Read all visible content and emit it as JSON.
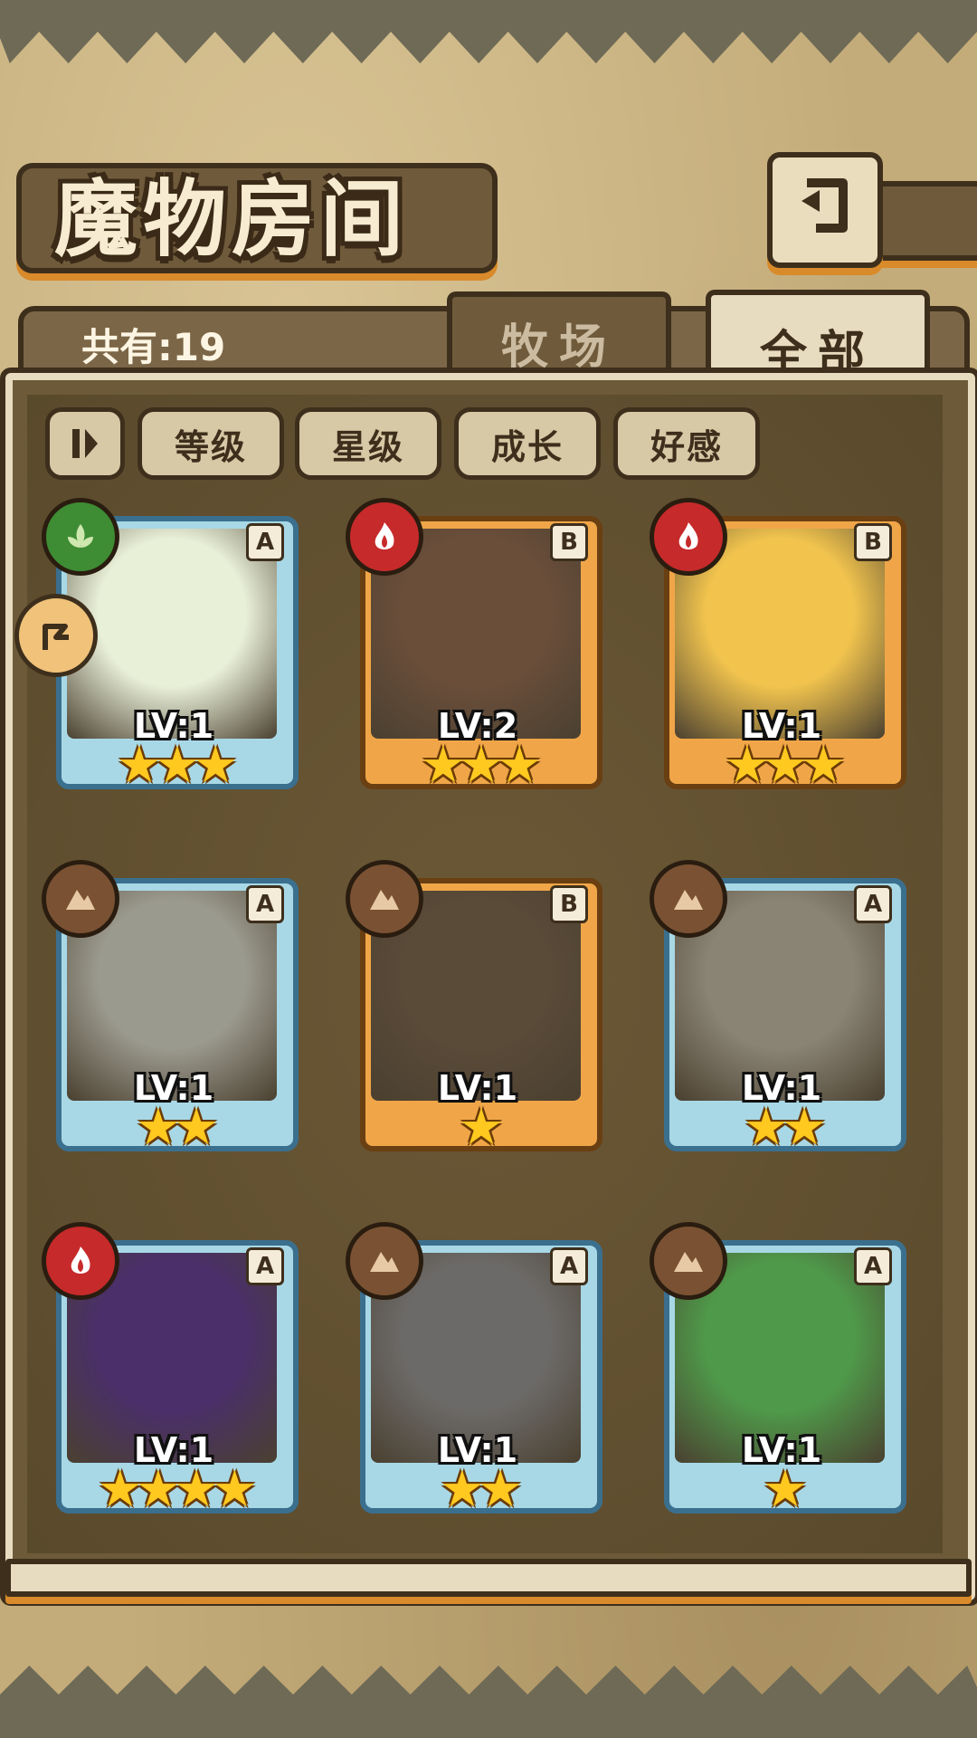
{
  "header": {
    "title": "魔物房间",
    "back_icon": "back-arrow-icon"
  },
  "tabs": {
    "count_label": "共有:19",
    "pasture": "牧场",
    "all": "全部"
  },
  "filters": {
    "toggle_icon": "pause-sort-icon",
    "buttons": [
      "等级",
      "星级",
      "成长",
      "好感"
    ]
  },
  "cards": [
    {
      "rank": "A",
      "element": "wood",
      "level": "LV:1",
      "stars": "★★★",
      "frame": "blue",
      "portrait_color": "#e9f0d8"
    },
    {
      "rank": "B",
      "element": "fire",
      "level": "LV:2",
      "stars": "★★★",
      "frame": "orange",
      "portrait_color": "#6a4e3a"
    },
    {
      "rank": "B",
      "element": "fire",
      "level": "LV:1",
      "stars": "★★★",
      "frame": "orange",
      "portrait_color": "#f2c44e"
    },
    {
      "rank": "A",
      "element": "earth",
      "level": "LV:1",
      "stars": "★★",
      "frame": "blue",
      "portrait_color": "#9b9a8e"
    },
    {
      "rank": "B",
      "element": "earth",
      "level": "LV:1",
      "stars": "★",
      "frame": "orange",
      "portrait_color": "#5a4a38"
    },
    {
      "rank": "A",
      "element": "earth",
      "level": "LV:1",
      "stars": "★★",
      "frame": "blue",
      "portrait_color": "#8a8474"
    },
    {
      "rank": "A",
      "element": "fire",
      "level": "LV:1",
      "stars": "★★★★",
      "frame": "blue",
      "portrait_color": "#4a2f6a"
    },
    {
      "rank": "A",
      "element": "earth",
      "level": "LV:1",
      "stars": "★★",
      "frame": "blue",
      "portrait_color": "#6c6a68"
    },
    {
      "rank": "A",
      "element": "earth",
      "level": "LV:1",
      "stars": "★",
      "frame": "blue",
      "portrait_color": "#4f9a4a"
    }
  ],
  "colors": {
    "accent_orange": "#d98a2a",
    "dark_brown": "#3d2f1c",
    "parchment": "#e8dcc0"
  }
}
